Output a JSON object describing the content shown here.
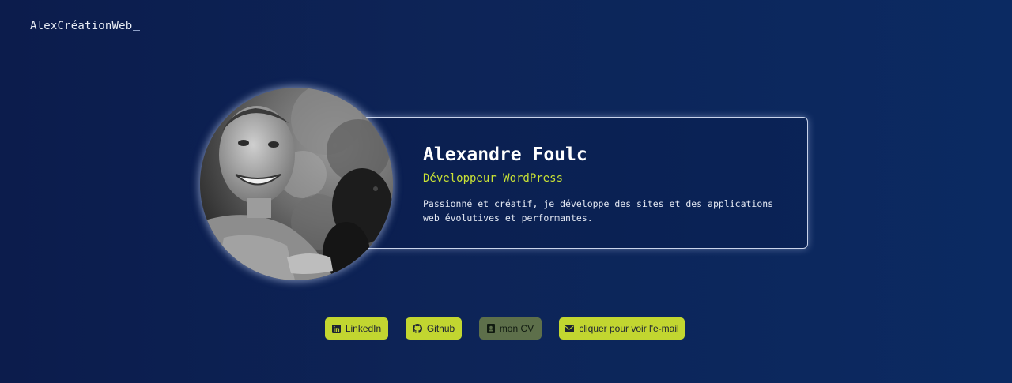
{
  "header": {
    "logo": "AlexCréationWeb"
  },
  "profile": {
    "name": "Alexandre Foulc",
    "role": "Développeur WordPress",
    "bio": "Passionné et créatif, je développe des sites et des applications web évolutives et performantes."
  },
  "links": {
    "linkedin": "LinkedIn",
    "github": "Github",
    "cv": "mon CV",
    "email": "cliquer pour voir l'e-mail"
  },
  "colors": {
    "accent": "#c2d630",
    "role_text": "#c9e235",
    "background": "#0d2457"
  },
  "icons": {
    "linkedin": "linkedin-icon",
    "github": "github-icon",
    "cv": "contact-card-icon",
    "email": "envelope-icon"
  }
}
